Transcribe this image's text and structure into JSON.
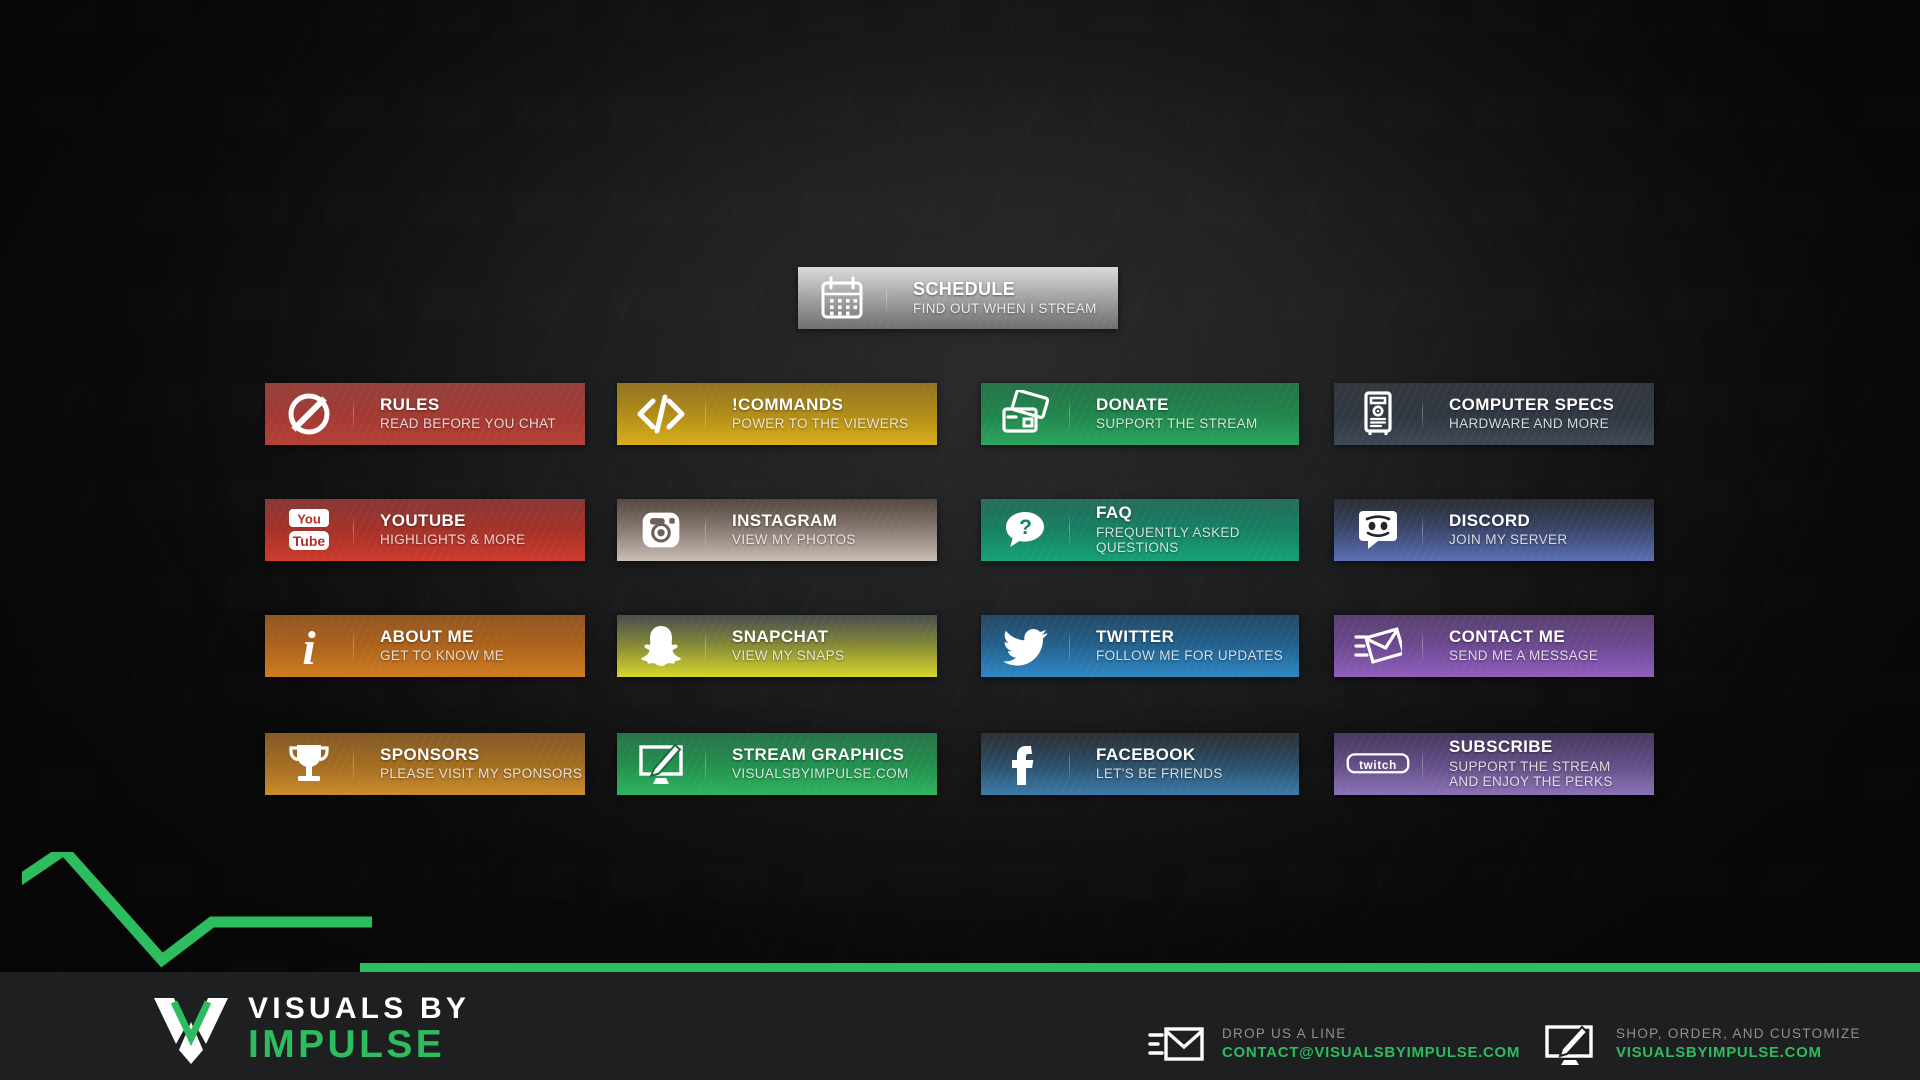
{
  "theme": {
    "brand_green": "#2dbd5f",
    "footer_bg": "#1e1f20",
    "page_bg": "#0e0e0f"
  },
  "schedule": {
    "title": "SCHEDULE",
    "subtitle": "FIND OUT WHEN I STREAM",
    "icon": "calendar-icon",
    "color_from": "#d6d6d6",
    "color_to": "#6e6f71"
  },
  "panels": [
    {
      "id": "rules",
      "title": "RULES",
      "subtitle": "READ BEFORE YOU CHAT",
      "icon": "no-entry-icon",
      "color_from": "#8d332f",
      "color_to": "#b64036"
    },
    {
      "id": "commands",
      "title": "!COMMANDS",
      "subtitle": "POWER TO THE VIEWERS",
      "icon": "code-brackets-icon",
      "color_from": "#8a6a12",
      "color_to": "#d8ae1c"
    },
    {
      "id": "donate",
      "title": "DONATE",
      "subtitle": "SUPPORT THE STREAM",
      "icon": "credit-cards-icon",
      "color_from": "#17673c",
      "color_to": "#2aa45c"
    },
    {
      "id": "computer-specs",
      "title": "COMPUTER SPECS",
      "subtitle": "HARDWARE AND MORE",
      "icon": "desktop-tower-icon",
      "color_from": "#23282f",
      "color_to": "#3c4854"
    },
    {
      "id": "youtube",
      "title": "YOUTUBE",
      "subtitle": "HIGHLIGHTS & MORE",
      "icon": "youtube-icon",
      "color_from": "#7e2a26",
      "color_to": "#cd3a2c"
    },
    {
      "id": "instagram",
      "title": "INSTAGRAM",
      "subtitle": "VIEW MY PHOTOS",
      "icon": "instagram-icon",
      "color_from": "#4a3a33",
      "color_to": "#c9bdb4"
    },
    {
      "id": "faq",
      "title": "FAQ",
      "subtitle": "FREQUENTLY ASKED\nQUESTIONS",
      "icon": "question-bubble-icon",
      "color_from": "#17604f",
      "color_to": "#15a178"
    },
    {
      "id": "discord",
      "title": "DISCORD",
      "subtitle": "JOIN MY SERVER",
      "icon": "discord-icon",
      "color_from": "#1b1f26",
      "color_to": "#5b6fb4"
    },
    {
      "id": "about-me",
      "title": "ABOUT ME",
      "subtitle": "GET TO KNOW ME",
      "icon": "info-italic-icon",
      "color_from": "#8a4a15",
      "color_to": "#cf7c21"
    },
    {
      "id": "snapchat",
      "title": "SNAPCHAT",
      "subtitle": "VIEW MY SNAPS",
      "icon": "snapchat-ghost-icon",
      "color_from": "#3b4140",
      "color_to": "#d6d62c"
    },
    {
      "id": "twitter",
      "title": "TWITTER",
      "subtitle": "FOLLOW ME FOR UPDATES",
      "icon": "twitter-bird-icon",
      "color_from": "#173c59",
      "color_to": "#2f87c4"
    },
    {
      "id": "contact-me",
      "title": "CONTACT ME",
      "subtitle": "SEND ME A MESSAGE",
      "icon": "envelope-send-icon",
      "color_from": "#4c3366",
      "color_to": "#8f5fbd"
    },
    {
      "id": "sponsors",
      "title": "SPONSORS",
      "subtitle": "PLEASE VISIT MY SPONSORS",
      "icon": "trophy-icon",
      "color_from": "#7a4d17",
      "color_to": "#c98b2c"
    },
    {
      "id": "stream-graphics",
      "title": "STREAM GRAPHICS",
      "subtitle": "VISUALSBYIMPULSE.COM",
      "icon": "monitor-brush-icon",
      "color_from": "#17693c",
      "color_to": "#2fb35f"
    },
    {
      "id": "facebook",
      "title": "FACEBOOK",
      "subtitle": "LET'S BE FRIENDS",
      "icon": "facebook-icon",
      "color_from": "#1c2126",
      "color_to": "#3b7ba8"
    },
    {
      "id": "subscribe",
      "title": "SUBSCRIBE",
      "subtitle": "SUPPORT THE STREAM\nAND ENJOY THE PERKS",
      "icon": "twitch-icon",
      "color_from": "#3a2a55",
      "color_to": "#8a72b5"
    }
  ],
  "footer": {
    "logo_line1": "VISUALS BY",
    "logo_line2": "IMPULSE",
    "logo_mark": "vbi-chevron-mark",
    "contact": {
      "icon": "envelope-send-icon",
      "label": "DROP US A LINE",
      "value": "CONTACT@VISUALSBYIMPULSE.COM"
    },
    "shop": {
      "icon": "monitor-brush-icon",
      "label": "SHOP, ORDER, AND CUSTOMIZE",
      "value": "VISUALSBYIMPULSE.COM"
    }
  }
}
